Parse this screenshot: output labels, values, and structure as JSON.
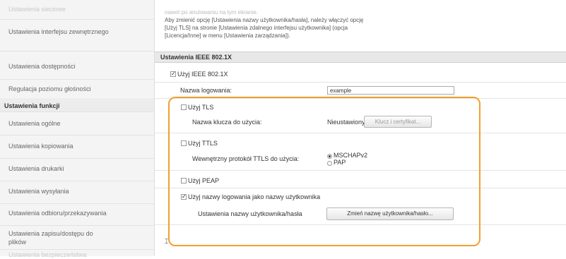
{
  "sidebar": {
    "items": [
      {
        "label": "Ustawienia sieciowe",
        "faded": true
      },
      {
        "label": "Ustawienia interfejsu zewnętrznego"
      },
      {
        "label": "Ustawienia dostępności"
      },
      {
        "label": "Regulacja poziomu głośności"
      },
      {
        "label": "Ustawienia funkcji",
        "section": true
      },
      {
        "label": "Ustawienia ogólne"
      },
      {
        "label": "Ustawienia kopiowania"
      },
      {
        "label": "Ustawienia drukarki"
      },
      {
        "label": "Ustawienia wysyłania"
      },
      {
        "label": "Ustawienia odbioru/przekazywania"
      },
      {
        "label": "Ustawienia zapisu/dostępu do plików"
      },
      {
        "label": "Ustawienia bezpieczeństwa",
        "faded": true
      }
    ]
  },
  "note": {
    "line1": "nawet po anulowaniu na tym ekranie.",
    "line2": "Aby zmienić opcję [Ustawienia nazwy użytkownika/hasła], należy włączyć opcję",
    "line3": "[Użyj TLS] na stronie [Ustawienia zdalnego interfejsu użytkownika] (opcja",
    "line4": "[Licencja/Inne] w menu [Ustawienia zarządzania])."
  },
  "ieee": {
    "header": "Ustawienia IEEE 802.1X",
    "use_ieee_label": "Użyj IEEE 802.1X",
    "use_ieee_checked": true,
    "login_label": "Nazwa logowania:",
    "login_value": "example"
  },
  "tls": {
    "label": "Użyj TLS",
    "checked": false,
    "key_label": "Nazwa klucza do użycia:",
    "key_value": "Nieustawiony.",
    "key_button": "Klucz i certyfikat..."
  },
  "ttls": {
    "label": "Użyj TTLS",
    "checked": false,
    "protocol_label": "Wewnętrzny protokół TTLS do użycia:",
    "options": [
      "MSCHAPv2",
      "PAP"
    ],
    "selected": "MSCHAPv2"
  },
  "peap": {
    "label": "Użyj PEAP",
    "checked": false
  },
  "username": {
    "label": "Użyj nazwy logowania jako nazwy użytkownika",
    "checked": true,
    "settings_label": "Ustawienia nazwy użytkownika/hasła",
    "change_button": "Zmień nazwę użytkownika/hasło..."
  },
  "footer_icon_glyph": "⌶",
  "colors": {
    "highlight": "#f0a030",
    "sidebar_bg": "#f4f4f4",
    "header_bg": "#e8e8e8"
  }
}
